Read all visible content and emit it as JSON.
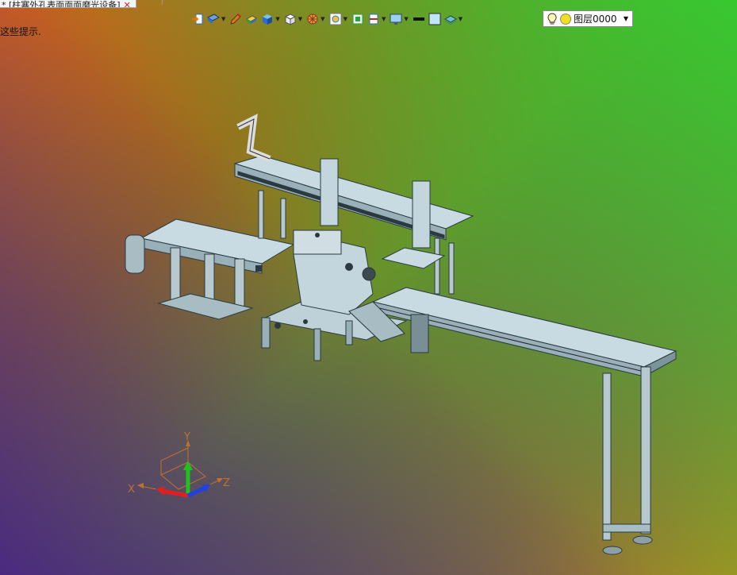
{
  "document_tab": {
    "title": "* [柱塞外孔表面面面磨光设备]",
    "close_glyph": "✕"
  },
  "hint_text": "这些提示.",
  "toolbar": {
    "items": [
      {
        "name": "import-icon"
      },
      {
        "name": "view-orient-icon"
      },
      {
        "name": "sketch-pen-icon"
      },
      {
        "name": "feature-block-icon"
      },
      {
        "name": "solid-cube-icon"
      },
      {
        "name": "wire-cube-icon"
      },
      {
        "name": "render-wheel-icon"
      },
      {
        "name": "view-zoom-icon"
      },
      {
        "name": "fit-view-icon"
      },
      {
        "name": "section-icon"
      },
      {
        "name": "display-monitor-icon"
      },
      {
        "name": "line-style-icon"
      },
      {
        "name": "color-swatch-icon"
      },
      {
        "name": "layer-stack-icon"
      }
    ],
    "colors": {
      "blue": "#2a6fd0",
      "orange": "#e07a10",
      "green": "#2aa040"
    }
  },
  "layer_selector": {
    "label": "图层0000"
  },
  "viewport": {
    "background_colors": [
      "#d6601a",
      "#38c830",
      "#4a2a80",
      "#b08a20"
    ]
  },
  "axis_triad": {
    "x_label": "X",
    "y_label": "Y",
    "z_label": "Z",
    "colors": {
      "x": "#e02020",
      "y": "#20c020",
      "z": "#2040e0"
    }
  }
}
